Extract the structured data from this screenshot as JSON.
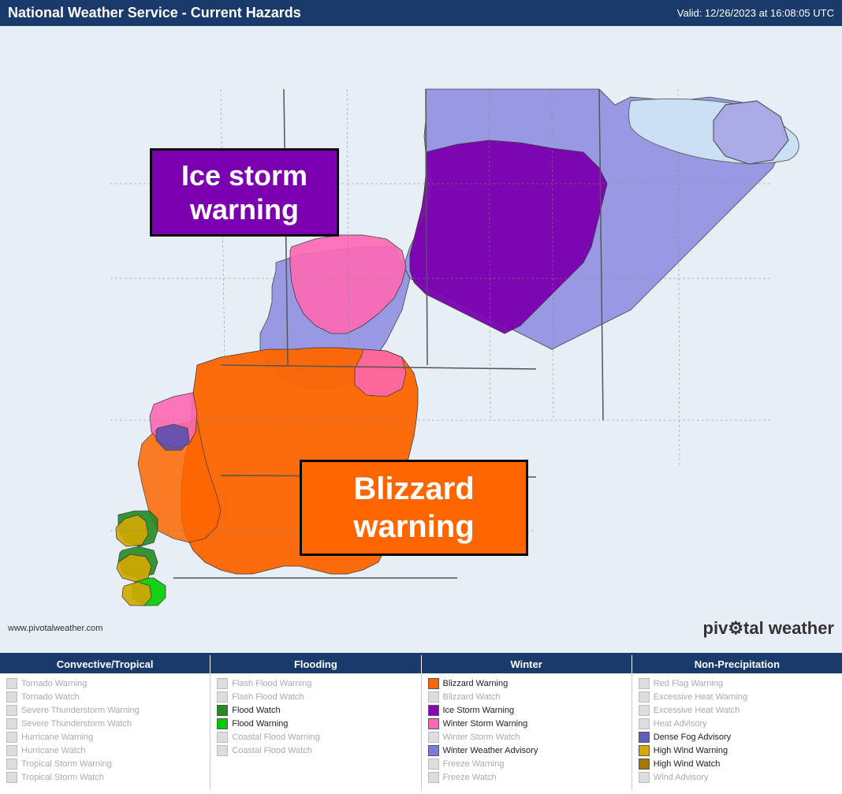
{
  "header": {
    "title": "National Weather Service - Current Hazards",
    "valid": "Valid: 12/26/2023 at 16:08:05 UTC"
  },
  "annotations": {
    "ice_storm": "Ice storm warning",
    "blizzard": "Blizzard warning"
  },
  "watermarks": {
    "left": "www.pivotalweather.com",
    "right": "piv⚙tal weather"
  },
  "legend": {
    "columns": [
      {
        "header": "Convective/Tropical",
        "items": [
          {
            "label": "Tornado Warning",
            "color": null,
            "active": false
          },
          {
            "label": "Tornado Watch",
            "color": null,
            "active": false
          },
          {
            "label": "Severe Thunderstorm Warning",
            "color": null,
            "active": false
          },
          {
            "label": "Severe Thunderstorm Watch",
            "color": null,
            "active": false
          },
          {
            "label": "Hurricane Warning",
            "color": null,
            "active": false
          },
          {
            "label": "Hurricane Watch",
            "color": null,
            "active": false
          },
          {
            "label": "Tropical Storm Warning",
            "color": null,
            "active": false
          },
          {
            "label": "Tropical Storm Watch",
            "color": null,
            "active": false
          }
        ]
      },
      {
        "header": "Flooding",
        "items": [
          {
            "label": "Flash Flood Warning",
            "color": null,
            "active": false
          },
          {
            "label": "Flash Flood Watch",
            "color": null,
            "active": false
          },
          {
            "label": "Flood Watch",
            "color": "#228b22",
            "active": true
          },
          {
            "label": "Flood Warning",
            "color": "#00cc00",
            "active": true
          },
          {
            "label": "Coastal Flood Warning",
            "color": null,
            "active": false
          },
          {
            "label": "Coastal Flood Watch",
            "color": null,
            "active": false
          }
        ]
      },
      {
        "header": "Winter",
        "items": [
          {
            "label": "Blizzard Warning",
            "color": "#ff6600",
            "active": true
          },
          {
            "label": "Blizzard Watch",
            "color": null,
            "active": false
          },
          {
            "label": "Ice Storm Warning",
            "color": "#8b00b0",
            "active": true
          },
          {
            "label": "Winter Storm Warning",
            "color": "#ff69b4",
            "active": true
          },
          {
            "label": "Winter Storm Watch",
            "color": null,
            "active": false
          },
          {
            "label": "Winter Weather Advisory",
            "color": "#7b7bdc",
            "active": true
          },
          {
            "label": "Freeze Warning",
            "color": null,
            "active": false
          },
          {
            "label": "Freeze Watch",
            "color": null,
            "active": false
          }
        ]
      },
      {
        "header": "Non-Precipitation",
        "items": [
          {
            "label": "Red Flag Warning",
            "color": null,
            "active": false
          },
          {
            "label": "Excessive Heat Warning",
            "color": null,
            "active": false
          },
          {
            "label": "Excessive Heat Watch",
            "color": null,
            "active": false
          },
          {
            "label": "Heat Advisory",
            "color": null,
            "active": false
          },
          {
            "label": "Dense Fog Advisory",
            "color": "#6060bb",
            "active": true
          },
          {
            "label": "High Wind Warning",
            "color": "#d4a800",
            "active": true
          },
          {
            "label": "High Wind Watch",
            "color": "#a07800",
            "active": true
          },
          {
            "label": "Wind Advisory",
            "color": null,
            "active": false
          }
        ]
      }
    ]
  }
}
